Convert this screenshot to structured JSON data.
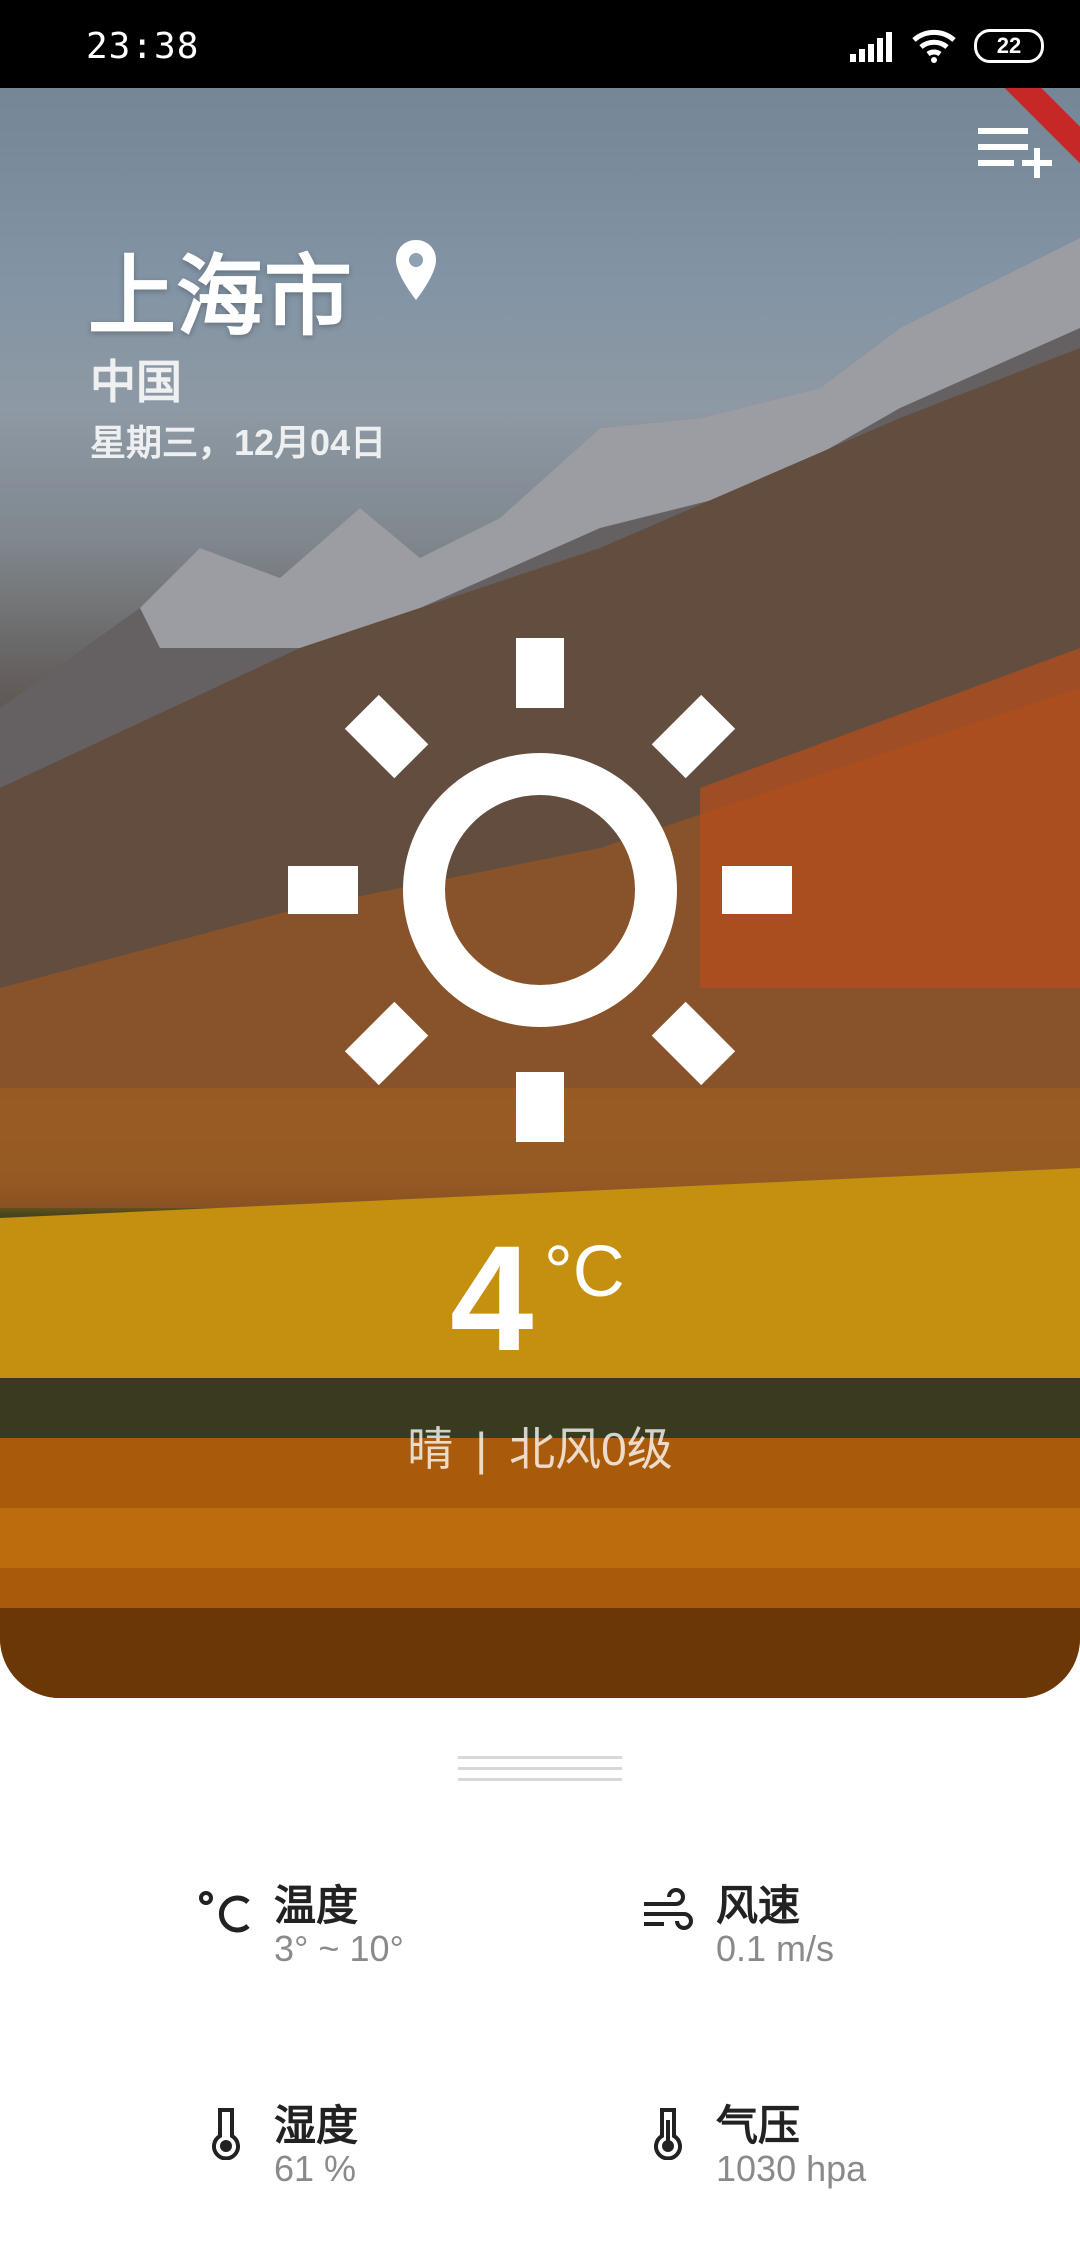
{
  "status_bar": {
    "time": "23:38",
    "battery": "22"
  },
  "header": {
    "city": "上海市",
    "country": "中国",
    "date": "星期三，12月04日"
  },
  "weather": {
    "temperature": "4",
    "unit": "°C",
    "condition": "晴",
    "separator": "|",
    "wind": "北风0级",
    "icon": "sun-icon"
  },
  "details": [
    {
      "icon": "celsius-icon",
      "label": "温度",
      "value": "3° ~ 10°"
    },
    {
      "icon": "wind-icon",
      "label": "风速",
      "value": "0.1 m/s"
    },
    {
      "icon": "humidity-icon",
      "label": "湿度",
      "value": "61 %"
    },
    {
      "icon": "thermometer-icon",
      "label": "气压",
      "value": "1030 hpa"
    }
  ],
  "colors": {
    "status_bar": "#000000",
    "text_primary": "#222222",
    "text_secondary": "#8a8a8a",
    "debug_ribbon": "#c62828"
  }
}
